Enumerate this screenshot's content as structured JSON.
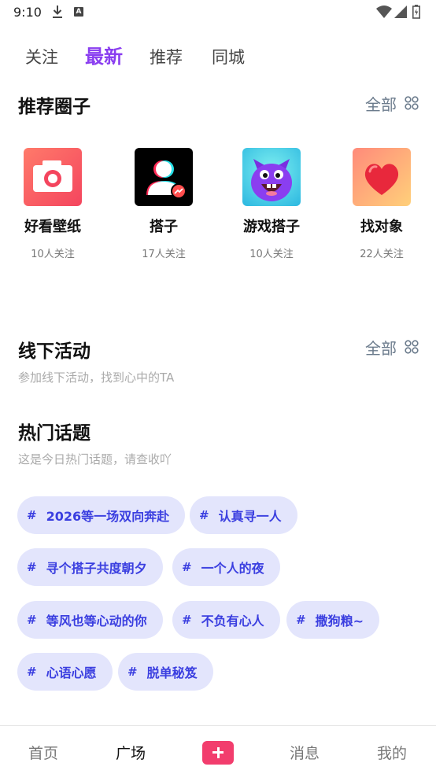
{
  "status_bar": {
    "time": "9:10",
    "a_label": "A"
  },
  "top_tabs": [
    {
      "label": "关注",
      "active": false
    },
    {
      "label": "最新",
      "active": true
    },
    {
      "label": "推荐",
      "active": false
    },
    {
      "label": "同城",
      "active": false
    }
  ],
  "recommend_circles": {
    "title": "推荐圈子",
    "more": "全部",
    "items": [
      {
        "name": "好看壁纸",
        "count": "10人关注",
        "icon": "camera-icon"
      },
      {
        "name": "搭子",
        "count": "17人关注",
        "icon": "partner-icon"
      },
      {
        "name": "游戏搭子",
        "count": "10人关注",
        "icon": "game-monster-icon"
      },
      {
        "name": "找对象",
        "count": "22人关注",
        "icon": "heart-icon"
      }
    ]
  },
  "offline_events": {
    "title": "线下活动",
    "subtitle": "参加线下活动，找到心中的TA",
    "more": "全部"
  },
  "hot_topics": {
    "title": "热门话题",
    "subtitle": "这是今日热门话题，请查收吖",
    "hash": "#",
    "tags": [
      "2026等一场双向奔赴",
      "认真寻一人",
      "寻个搭子共度朝夕",
      "一个人的夜",
      "等风也等心动的你",
      "不负有心人",
      "撒狗粮~",
      "心语心愿",
      "脱单秘笈"
    ]
  },
  "bottom_nav": [
    {
      "label": "首页",
      "active": false
    },
    {
      "label": "广场",
      "active": true
    },
    {
      "label": "",
      "icon": "add-icon"
    },
    {
      "label": "消息",
      "active": false
    },
    {
      "label": "我的",
      "active": false
    }
  ],
  "colors": {
    "accent": "#8a3ef0",
    "tag_bg": "#e3e5fc",
    "tag_text": "#3b3fe0",
    "add_button": "#f23d6d"
  }
}
